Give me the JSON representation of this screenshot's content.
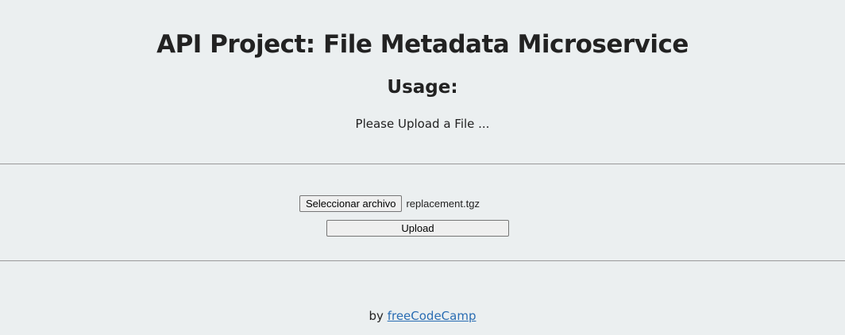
{
  "header": {
    "title": "API Project: File Metadata Microservice",
    "subtitle": "Usage:",
    "instruction": "Please Upload a File ..."
  },
  "form": {
    "file_button_label": "Seleccionar archivo",
    "selected_file_name": "replacement.tgz",
    "upload_button_label": "Upload"
  },
  "footer": {
    "prefix": "by",
    "link_text": "freeCodeCamp"
  },
  "colors": {
    "background": "#ebeff0",
    "text": "#222222",
    "link": "#2a6db3",
    "divider": "#9a9a9a"
  }
}
